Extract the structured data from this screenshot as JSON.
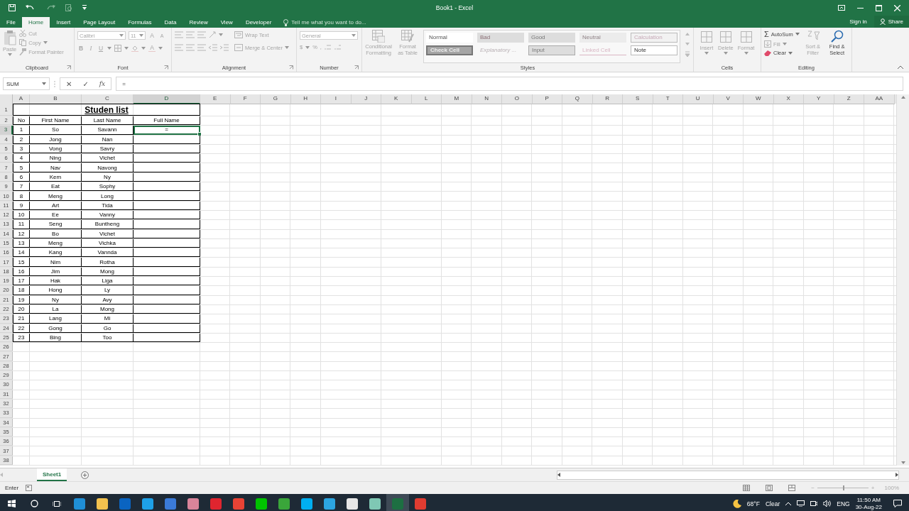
{
  "title_bar": {
    "title": "Book1 - Excel",
    "sign_in": "Sign in",
    "share": "Share"
  },
  "menu_tabs": [
    {
      "label": "File",
      "selected": false
    },
    {
      "label": "Home",
      "selected": true
    },
    {
      "label": "Insert",
      "selected": false
    },
    {
      "label": "Page Layout",
      "selected": false
    },
    {
      "label": "Formulas",
      "selected": false
    },
    {
      "label": "Data",
      "selected": false
    },
    {
      "label": "Review",
      "selected": false
    },
    {
      "label": "View",
      "selected": false
    },
    {
      "label": "Developer",
      "selected": false
    }
  ],
  "tell_me": {
    "placeholder": "Tell me what you want to do..."
  },
  "ribbon": {
    "disabled": true,
    "clipboard": {
      "title": "Clipboard",
      "paste": "Paste",
      "cut": "Cut",
      "copy": "Copy",
      "format_painter": "Format Painter"
    },
    "font": {
      "title": "Font",
      "font_name": "Calibri",
      "font_size": "11",
      "grow": "A",
      "shrink": "A",
      "bold": "B",
      "italic": "I",
      "underline": "U",
      "font_color": "A"
    },
    "alignment": {
      "title": "Alignment",
      "wrap_text": "Wrap Text",
      "merge_center": "Merge & Center"
    },
    "number": {
      "title": "Number",
      "format": "General",
      "currency": "$",
      "percent": "%",
      "comma": ","
    },
    "styles": {
      "title": "Styles",
      "conditional_formatting": "Conditional Formatting",
      "format_as_table": "Format as Table",
      "gallery": [
        {
          "label": "Normal",
          "kind": "normal"
        },
        {
          "label": "Bad",
          "kind": "bad"
        },
        {
          "label": "Good",
          "kind": "good"
        },
        {
          "label": "Neutral",
          "kind": "neutral"
        },
        {
          "label": "Calculation",
          "kind": "calculation"
        },
        {
          "label": "Check Cell",
          "kind": "check"
        },
        {
          "label": "Explanatory ...",
          "kind": "explanatory"
        },
        {
          "label": "Input",
          "kind": "input"
        },
        {
          "label": "Linked Cell",
          "kind": "linked"
        },
        {
          "label": "Note",
          "kind": "note"
        }
      ]
    },
    "cells": {
      "title": "Cells",
      "buttons": [
        "Insert",
        "Delete",
        "Format"
      ]
    },
    "editing": {
      "title": "Editing",
      "autosum_symbol": "Σ",
      "autosum": "AutoSum",
      "fill": "Fill",
      "clear": "Clear",
      "sort_filter": "Sort & Filter",
      "find_select": "Find & Select"
    }
  },
  "formula_bar": {
    "name_box": "SUM",
    "cancel": "✕",
    "enter": "✓",
    "function": "fx",
    "formula": "="
  },
  "column_headers": [
    {
      "label": "A",
      "selected": false
    },
    {
      "label": "B",
      "selected": false
    },
    {
      "label": "C",
      "selected": false
    },
    {
      "label": "D",
      "selected": true
    },
    {
      "label": "E",
      "selected": false
    },
    {
      "label": "F",
      "selected": false
    },
    {
      "label": "G",
      "selected": false
    },
    {
      "label": "H",
      "selected": false
    },
    {
      "label": "I",
      "selected": false
    },
    {
      "label": "J",
      "selected": false
    },
    {
      "label": "K",
      "selected": false
    },
    {
      "label": "L",
      "selected": false
    },
    {
      "label": "M",
      "selected": false
    },
    {
      "label": "N",
      "selected": false
    },
    {
      "label": "O",
      "selected": false
    },
    {
      "label": "P",
      "selected": false
    },
    {
      "label": "Q",
      "selected": false
    },
    {
      "label": "R",
      "selected": false
    },
    {
      "label": "S",
      "selected": false
    },
    {
      "label": "T",
      "selected": false
    },
    {
      "label": "U",
      "selected": false
    },
    {
      "label": "V",
      "selected": false
    },
    {
      "label": "W",
      "selected": false
    },
    {
      "label": "X",
      "selected": false
    },
    {
      "label": "Y",
      "selected": false
    },
    {
      "label": "Z",
      "selected": false
    },
    {
      "label": "AA",
      "selected": false
    }
  ],
  "row_headers": [
    {
      "label": "1",
      "selected": false
    },
    {
      "label": "2",
      "selected": false
    },
    {
      "label": "3",
      "selected": true
    },
    {
      "label": "4",
      "selected": false
    },
    {
      "label": "5",
      "selected": false
    },
    {
      "label": "6",
      "selected": false
    },
    {
      "label": "7",
      "selected": false
    },
    {
      "label": "8",
      "selected": false
    },
    {
      "label": "9",
      "selected": false
    },
    {
      "label": "10",
      "selected": false
    },
    {
      "label": "11",
      "selected": false
    },
    {
      "label": "12",
      "selected": false
    },
    {
      "label": "13",
      "selected": false
    },
    {
      "label": "14",
      "selected": false
    },
    {
      "label": "15",
      "selected": false
    },
    {
      "label": "16",
      "selected": false
    },
    {
      "label": "17",
      "selected": false
    },
    {
      "label": "18",
      "selected": false
    },
    {
      "label": "19",
      "selected": false
    },
    {
      "label": "20",
      "selected": false
    },
    {
      "label": "21",
      "selected": false
    },
    {
      "label": "22",
      "selected": false
    },
    {
      "label": "23",
      "selected": false
    },
    {
      "label": "24",
      "selected": false
    },
    {
      "label": "25",
      "selected": false
    },
    {
      "label": "26",
      "selected": false
    },
    {
      "label": "27",
      "selected": false
    },
    {
      "label": "28",
      "selected": false
    },
    {
      "label": "29",
      "selected": false
    },
    {
      "label": "30",
      "selected": false
    },
    {
      "label": "31",
      "selected": false
    },
    {
      "label": "32",
      "selected": false
    },
    {
      "label": "33",
      "selected": false
    },
    {
      "label": "34",
      "selected": false
    },
    {
      "label": "35",
      "selected": false
    },
    {
      "label": "36",
      "selected": false
    },
    {
      "label": "37",
      "selected": false
    },
    {
      "label": "38",
      "selected": false
    }
  ],
  "sheet": {
    "title": "Studen list",
    "headers": [
      "No",
      "First Name",
      "Last Name",
      "Full Name"
    ],
    "rows": [
      {
        "no": "1",
        "first_name": "So",
        "last_name": "Savann",
        "full_name": "=",
        "selected": true
      },
      {
        "no": "2",
        "first_name": "Jong",
        "last_name": "Nan",
        "selected": false
      },
      {
        "no": "3",
        "first_name": "Vong",
        "last_name": "Savry",
        "selected": false
      },
      {
        "no": "4",
        "first_name": "Ning",
        "last_name": "Vichet",
        "selected": false
      },
      {
        "no": "5",
        "first_name": "Nav",
        "last_name": "Navong",
        "selected": false
      },
      {
        "no": "6",
        "first_name": "Kem",
        "last_name": "Ny",
        "selected": false
      },
      {
        "no": "7",
        "first_name": "Eat",
        "last_name": "Sophy",
        "selected": false
      },
      {
        "no": "8",
        "first_name": "Meng",
        "last_name": "Long",
        "selected": false
      },
      {
        "no": "9",
        "first_name": "Art",
        "last_name": "Tida",
        "selected": false
      },
      {
        "no": "10",
        "first_name": "Ee",
        "last_name": "Vanny",
        "selected": false
      },
      {
        "no": "11",
        "first_name": "Seng",
        "last_name": "Buntheng",
        "selected": false
      },
      {
        "no": "12",
        "first_name": "Bo",
        "last_name": "Vichet",
        "selected": false
      },
      {
        "no": "13",
        "first_name": "Meng",
        "last_name": "Vichka",
        "selected": false
      },
      {
        "no": "14",
        "first_name": "Kang",
        "last_name": "Vannda",
        "selected": false
      },
      {
        "no": "15",
        "first_name": "Nim",
        "last_name": "Rotha",
        "selected": false
      },
      {
        "no": "16",
        "first_name": "Jim",
        "last_name": "Mong",
        "selected": false
      },
      {
        "no": "17",
        "first_name": "Hak",
        "last_name": "Liga",
        "selected": false
      },
      {
        "no": "18",
        "first_name": "Hong",
        "last_name": "Ly",
        "selected": false
      },
      {
        "no": "19",
        "first_name": "Ny",
        "last_name": "Avy",
        "selected": false
      },
      {
        "no": "20",
        "first_name": "La",
        "last_name": "Mong",
        "selected": false
      },
      {
        "no": "21",
        "first_name": "Lang",
        "last_name": "Mi",
        "selected": false
      },
      {
        "no": "22",
        "first_name": "Gong",
        "last_name": "Go",
        "selected": false
      },
      {
        "no": "23",
        "first_name": "Bing",
        "last_name": "Too",
        "selected": false
      }
    ]
  },
  "sheet_tabs": [
    {
      "label": "Sheet1",
      "selected": true
    }
  ],
  "status_bar": {
    "mode": "Enter",
    "zoom": {
      "minus": "−",
      "plus": "+",
      "level": 0.5,
      "reading": "100%"
    }
  },
  "taskbar": {
    "apps": [
      {
        "color": "#1f8fd6",
        "selected": false
      },
      {
        "color": "#f2c14e",
        "selected": false
      },
      {
        "color": "#0a64c1",
        "selected": false
      },
      {
        "color": "#1ea1e8",
        "selected": false
      },
      {
        "color": "#3b7bd8",
        "selected": false
      },
      {
        "color": "#d9849a",
        "selected": false
      },
      {
        "color": "#e0252f",
        "selected": false
      },
      {
        "color": "#ea4335",
        "selected": false
      },
      {
        "color": "#00c300",
        "selected": false
      },
      {
        "color": "#3aa63a",
        "selected": false
      },
      {
        "color": "#00aff0",
        "selected": false
      },
      {
        "color": "#2ca5e0",
        "selected": false
      },
      {
        "color": "#e6e6e6",
        "selected": false
      },
      {
        "color": "#7fc8b4",
        "selected": false
      },
      {
        "color": "#1d6f42",
        "selected": true
      },
      {
        "color": "#e03c31",
        "selected": false
      }
    ],
    "weather_temp": "68°F",
    "weather": "Clear",
    "language": "ENG",
    "time": "11:50 AM",
    "date": "30-Aug-22"
  }
}
